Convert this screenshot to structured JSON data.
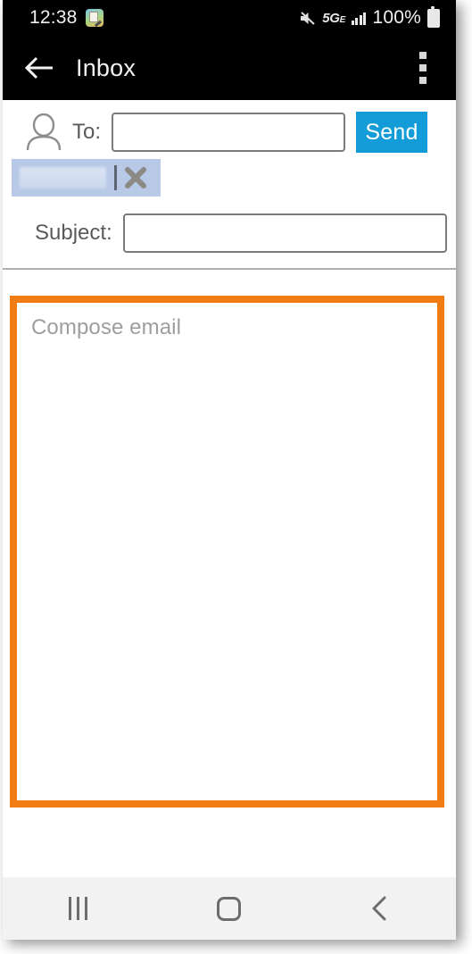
{
  "status_bar": {
    "clock": "12:38",
    "notification_icon": "note-app-icon",
    "mute_icon": "volume-mute-icon",
    "network_type": "5G",
    "network_suffix": "E",
    "signal_icon": "signal-bars-icon",
    "battery_percent": "100%",
    "battery_icon": "battery-full-icon"
  },
  "app_bar": {
    "back_icon": "back-arrow-icon",
    "title": "Inbox",
    "overflow_icon": "overflow-menu-icon"
  },
  "compose": {
    "to": {
      "contact_icon": "person-icon",
      "label": "To:",
      "value": "",
      "placeholder": ""
    },
    "send_button": {
      "label": "Send",
      "color": "#139cd8"
    },
    "recipient_chip": {
      "name": "",
      "redacted": true,
      "remove_icon": "close-x-icon"
    },
    "subject": {
      "label": "Subject:",
      "value": "",
      "placeholder": ""
    },
    "body": {
      "placeholder": "Compose email",
      "value": "",
      "highlight_color": "#f07c13"
    }
  },
  "nav_bar": {
    "recents_icon": "recents-icon",
    "home_icon": "home-icon",
    "back_icon": "back-chevron-icon"
  }
}
